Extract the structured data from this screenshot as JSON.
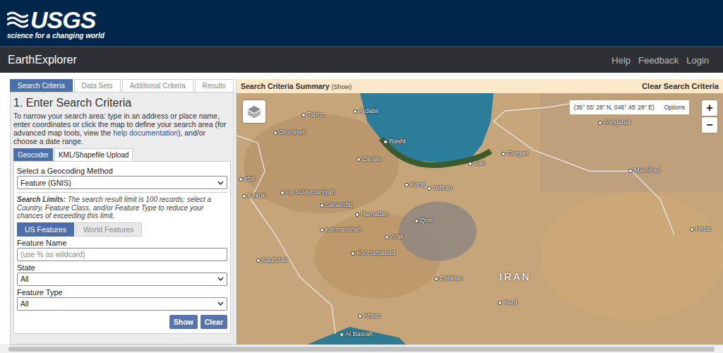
{
  "header": {
    "logo": "USGS",
    "tagline": "science for a changing world"
  },
  "nav": {
    "title": "EarthExplorer",
    "links": [
      "Help",
      "Feedback",
      "Login"
    ]
  },
  "tabs": [
    {
      "label": "Search Criteria",
      "selected": true
    },
    {
      "label": "Data Sets",
      "selected": false
    },
    {
      "label": "Additional Criteria",
      "selected": false
    },
    {
      "label": "Results",
      "selected": false
    }
  ],
  "panel": {
    "heading": "1. Enter Search Criteria",
    "intro": {
      "before": "To narrow your search area: type in an address or place name, enter coordinates or click the map to define your search area (for advanced map tools, view the ",
      "link": "help documentation",
      "after": "), and/or choose a date range."
    },
    "subtabs": [
      {
        "label": "Geocoder",
        "selected": true
      },
      {
        "label": "KML/Shapefile Upload",
        "selected": false
      }
    ],
    "method_label": "Select a Geocoding Method",
    "method_value": "Feature (GNIS)",
    "limits": {
      "label": "Search Limits:",
      "text": " The search result limit is 100 records; select a Country, Feature Class, and/or Feature Type to reduce your chances of exceeding this limit."
    },
    "feature_toggle": [
      {
        "label": "US Features",
        "selected": true
      },
      {
        "label": "World Features",
        "selected": false
      }
    ],
    "fields": [
      {
        "label": "Feature Name",
        "kind": "input",
        "placeholder": "(use % as wildcard)",
        "value": ""
      },
      {
        "label": "State",
        "kind": "select",
        "placeholder": "",
        "value": "All"
      },
      {
        "label": "Feature Type",
        "kind": "select",
        "placeholder": "",
        "value": "All"
      }
    ],
    "buttons": [
      "Show",
      "Clear"
    ]
  },
  "map": {
    "summary_title": "Search Criteria Summary",
    "summary_toggle": "(Show)",
    "clear": "Clear Search Criteria",
    "coordinates": "(35° 55' 28\" N, 046° 45' 28\" E)",
    "options": "Options",
    "zoom": [
      "+",
      "−"
    ],
    "country": "IRAN",
    "places": [
      {
        "name": "Tabriz"
      },
      {
        "name": "Ardabil"
      },
      {
        "name": "Orumiyeh"
      },
      {
        "name": "Ashgabat"
      },
      {
        "name": "Rasht"
      },
      {
        "name": "Zanjan"
      },
      {
        "name": "Gurgan"
      },
      {
        "name": "Sari"
      },
      {
        "name": "Mashhad"
      },
      {
        "name": "Irbil"
      },
      {
        "name": "Karaj"
      },
      {
        "name": "Tehran"
      },
      {
        "name": "Kirkuk"
      },
      {
        "name": "As Sulaymaniyah"
      },
      {
        "name": "Sanandaj"
      },
      {
        "name": "Hamadan"
      },
      {
        "name": "Qom"
      },
      {
        "name": "Kermanshah"
      },
      {
        "name": "Herat"
      },
      {
        "name": "Arak"
      },
      {
        "name": "Khorramabad"
      },
      {
        "name": "Baghdad"
      },
      {
        "name": "Esfahan"
      },
      {
        "name": "Yazd"
      },
      {
        "name": "Ahvaz"
      },
      {
        "name": "Al Basrah"
      }
    ]
  }
}
